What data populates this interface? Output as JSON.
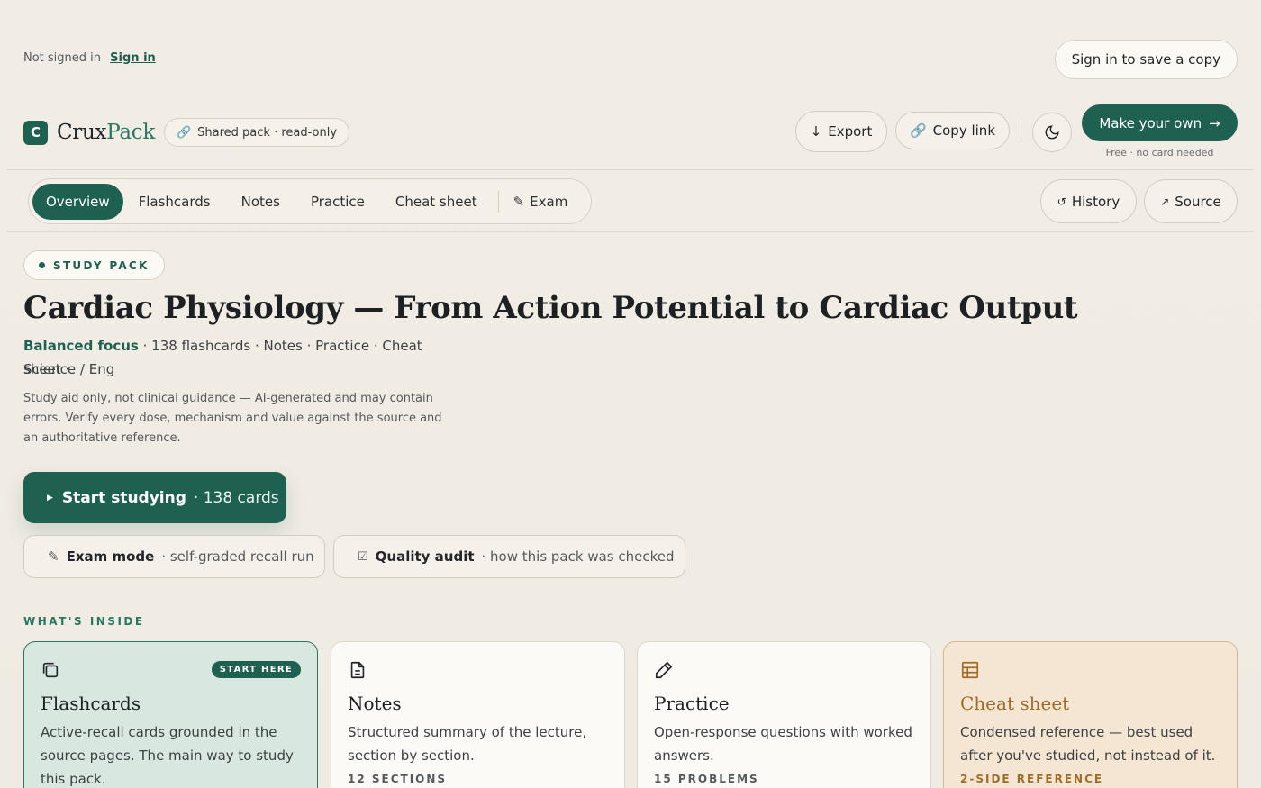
{
  "auth": {
    "status": "Not signed in",
    "sign_in": "Sign in",
    "save_copy": "Sign in to save a copy"
  },
  "brand": {
    "name_part1": "Crux",
    "name_part2": "Pack",
    "logo_glyph": "C",
    "shared_label": "Shared pack · read-only",
    "accent_color": "#1f6150"
  },
  "header": {
    "export": "Export",
    "copy_link": "Copy link",
    "make_own": "Make your own",
    "make_own_sub": "Free · no card needed"
  },
  "tabs": [
    {
      "label": "Overview",
      "active": true
    },
    {
      "label": "Flashcards"
    },
    {
      "label": "Notes"
    },
    {
      "label": "Practice"
    },
    {
      "label": "Cheat sheet"
    },
    {
      "label": "Exam"
    }
  ],
  "right_actions": {
    "history": "History",
    "source": "Source"
  },
  "hero": {
    "badge": "STUDY PACK",
    "title": "Cardiac Physiology — From Action Potential to Cardiac Output",
    "focus": "Balanced focus",
    "meta": "· 138 flashcards · Notes · Practice · Cheat sheet ·",
    "subject": "Science / Eng",
    "disclaimer": "Study aid only, not clinical guidance — AI-generated and may contain errors. Verify every dose, mechanism and value against the source and an authoritative reference."
  },
  "actions": {
    "start_label": "Start studying",
    "start_sub": "· 138 cards",
    "exam_label": "Exam mode",
    "exam_sub": "· self-graded recall run",
    "audit_label": "Quality audit",
    "audit_sub": "· how this pack was checked"
  },
  "inside": {
    "label": "WHAT'S INSIDE",
    "cards": [
      {
        "title": "Flashcards",
        "desc": "Active-recall cards grounded in the source pages. The main way to study this pack.",
        "badge": "START HERE",
        "icon": "cards-icon"
      },
      {
        "title": "Notes",
        "desc": "Structured summary of the lecture, section by section.",
        "foot": "12 SECTIONS",
        "icon": "document-icon"
      },
      {
        "title": "Practice",
        "desc": "Open-response questions with worked answers.",
        "foot": "15 PROBLEMS",
        "icon": "pencil-icon"
      },
      {
        "title": "Cheat sheet",
        "desc": "Condensed reference — best used after you've studied, not instead of it.",
        "foot": "2-SIDE REFERENCE",
        "icon": "table-icon"
      }
    ]
  }
}
